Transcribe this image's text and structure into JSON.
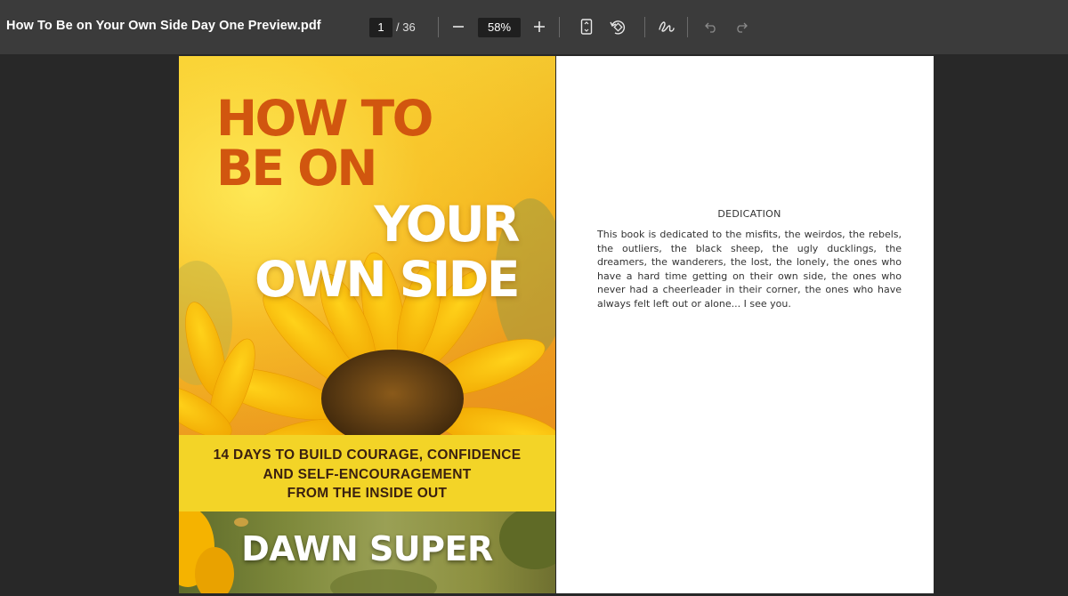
{
  "toolbar": {
    "document_title": "How To Be on Your Own Side Day One Preview.pdf",
    "current_page": "1",
    "page_total": "/ 36",
    "zoom": "58%",
    "icons": [
      "zoom-out-icon",
      "zoom-in-icon",
      "fit-page-icon",
      "rotate-icon",
      "draw-icon",
      "undo-icon",
      "redo-icon"
    ]
  },
  "cover": {
    "title_line1": "HOW TO",
    "title_line2": "BE ON",
    "title_line3": "YOUR",
    "title_line4": "OWN SIDE",
    "subtitle_line1": "14 DAYS TO BUILD COURAGE, CONFIDENCE",
    "subtitle_line2": "AND SELF-ENCOURAGEMENT",
    "subtitle_line3": "FROM THE INSIDE OUT",
    "author": "DAWN SUPER"
  },
  "dedication": {
    "heading": "DEDICATION",
    "body": "This book is dedicated to the misfits, the weirdos, the rebels, the outliers, the black sheep, the ugly ducklings, the dreamers, the wanderers, the lost, the lonely, the ones who have a hard time getting on their own side, the ones who never had a cheerleader in their corner, the ones who have always felt left out or alone... I see you."
  },
  "colors": {
    "toolbar": "#3b3b3b",
    "background": "#282828",
    "cover_title_dark": "#d1560f",
    "cover_band": "#f3d427"
  }
}
